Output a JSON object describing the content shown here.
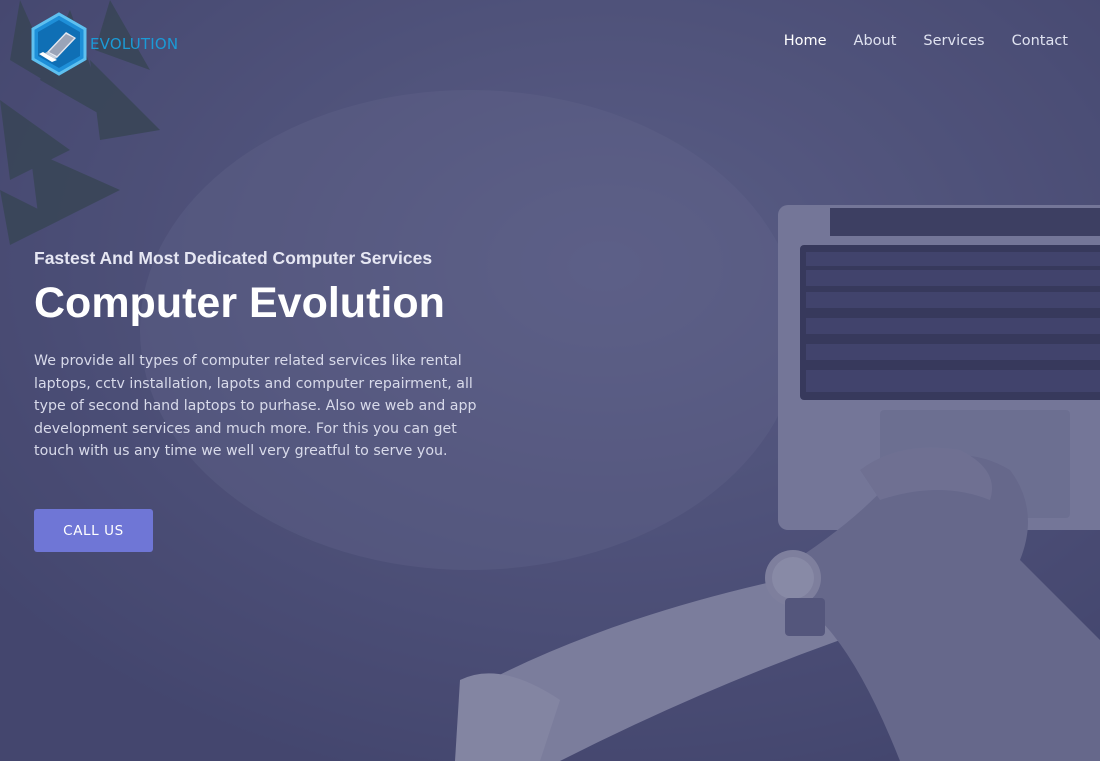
{
  "brand": {
    "logo_text": "EVOLUTION",
    "logo_icon": "laptop-hexagon-icon",
    "accent_color": "#1b9ad6"
  },
  "nav": {
    "items": [
      {
        "label": "Home",
        "active": true
      },
      {
        "label": "About",
        "active": false
      },
      {
        "label": "Services",
        "active": false
      },
      {
        "label": "Contact",
        "active": false
      }
    ]
  },
  "hero": {
    "subtitle": "Fastest And Most Dedicated Computer Services",
    "title": "Computer Evolution",
    "description": "We provide all types of computer related services like rental laptops, cctv installation, lapots and computer repairment, all type of second hand laptops to purhase. Also we web and app development services and much more. For this you can get touch with us any time we well very greatful to serve you.",
    "cta_label": "CALL US",
    "cta_color": "#6f76d6",
    "overlay_color": "#40426e"
  }
}
